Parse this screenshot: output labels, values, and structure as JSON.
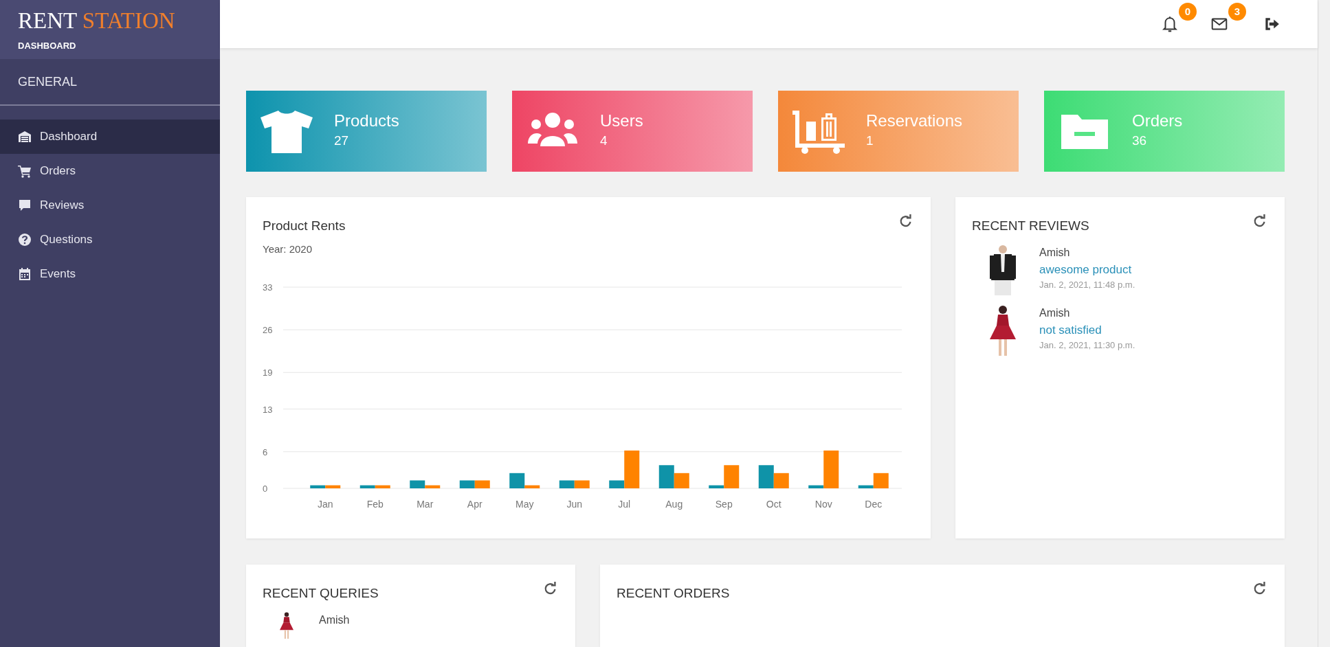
{
  "brand": {
    "title_first": "RENT",
    "title_second": "STATION",
    "subtitle": "DASHBOARD"
  },
  "sidebar": {
    "section": "GENERAL",
    "items": [
      {
        "label": "Dashboard",
        "selected": true
      },
      {
        "label": "Orders",
        "selected": false
      },
      {
        "label": "Reviews",
        "selected": false
      },
      {
        "label": "Questions",
        "selected": false
      },
      {
        "label": "Events",
        "selected": false
      }
    ]
  },
  "header": {
    "notifications": {
      "count": "0"
    },
    "messages": {
      "count": "3"
    }
  },
  "stats": [
    {
      "label": "Products",
      "value": "27",
      "color": "#0d93ad"
    },
    {
      "label": "Users",
      "value": "4",
      "color": "#ee4564"
    },
    {
      "label": "Reservations",
      "value": "1",
      "color": "#f4883a"
    },
    {
      "label": "Orders",
      "value": "36",
      "color": "#3ddc74"
    }
  ],
  "product_rents": {
    "title": "Product Rents",
    "subtitle": "Year: 2020",
    "chart_data": {
      "type": "bar",
      "categories": [
        "Jan",
        "Feb",
        "Mar",
        "Apr",
        "May",
        "Jun",
        "Jul",
        "Aug",
        "Sep",
        "Oct",
        "Nov",
        "Dec"
      ],
      "series": [
        {
          "color": "#0f93a8",
          "values": [
            0.5,
            0.5,
            1.3,
            1.3,
            2.5,
            1.3,
            1.3,
            3.8,
            0.5,
            3.8,
            0.5,
            0.5
          ]
        },
        {
          "color": "#ff8300",
          "values": [
            0.5,
            0.5,
            0.5,
            1.3,
            0.5,
            1.3,
            6.2,
            2.5,
            3.8,
            2.5,
            6.2,
            2.5
          ]
        }
      ],
      "ylim": [
        0,
        33
      ],
      "yticks": [
        0,
        6,
        13,
        19,
        26,
        33
      ],
      "grid": true
    }
  },
  "recent_reviews": {
    "title": "RECENT REVIEWS",
    "items": [
      {
        "name": "Amish",
        "text": "awesome product",
        "date": "Jan. 2, 2021, 11:48 p.m.",
        "kind": "picture"
      },
      {
        "name": "Amish",
        "text": "not satisfied",
        "date": "Jan. 2, 2021, 11:30 p.m.",
        "kind": "picture"
      }
    ]
  },
  "recent_queries": {
    "title": "RECENT QUERIES",
    "items": [
      {
        "name": "Amish",
        "kind": "picture"
      }
    ]
  },
  "recent_orders": {
    "title": "RECENT ORDERS"
  }
}
